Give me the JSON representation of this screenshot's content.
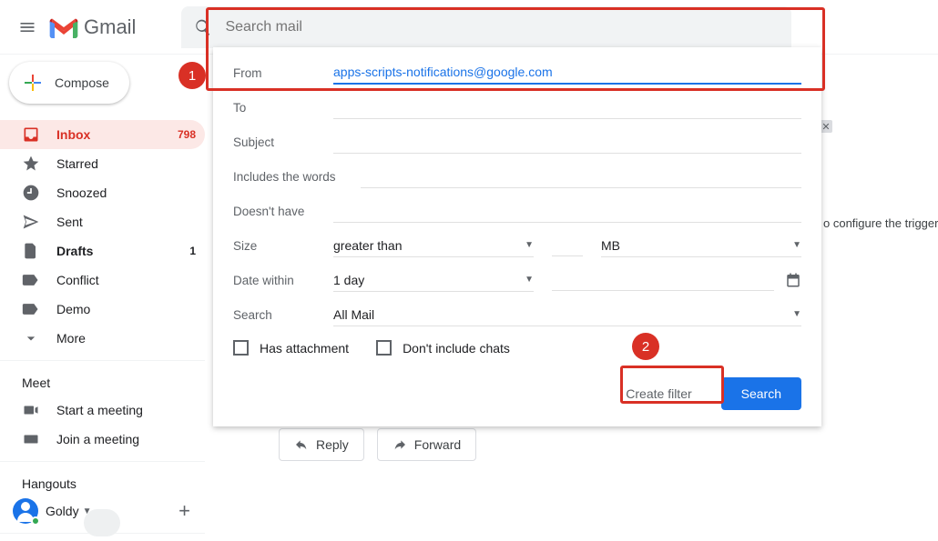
{
  "header": {
    "brand": "Gmail",
    "search_placeholder": "Search mail"
  },
  "compose_label": "Compose",
  "nav": [
    {
      "label": "Inbox",
      "count": "798"
    },
    {
      "label": "Starred"
    },
    {
      "label": "Snoozed"
    },
    {
      "label": "Sent"
    },
    {
      "label": "Drafts",
      "count": "1"
    },
    {
      "label": "Conflict"
    },
    {
      "label": "Demo"
    },
    {
      "label": "More"
    }
  ],
  "meet": {
    "title": "Meet",
    "start": "Start a meeting",
    "join": "Join a meeting"
  },
  "hangouts": {
    "title": "Hangouts",
    "user": "Goldy"
  },
  "filter": {
    "from_label": "From",
    "from_value": "apps-scripts-notifications@google.com",
    "to_label": "To",
    "subject_label": "Subject",
    "includes_label": "Includes the words",
    "doesnt_label": "Doesn't have",
    "size_label": "Size",
    "size_op": "greater than",
    "size_unit": "MB",
    "date_label": "Date within",
    "date_val": "1 day",
    "search_label": "Search",
    "search_val": "All Mail",
    "attach_label": "Has attachment",
    "chats_label": "Don't include chats",
    "create_filter": "Create filter",
    "search_btn": "Search"
  },
  "back_text": "o configure the triggers fo",
  "callouts": {
    "one": "1",
    "two": "2"
  },
  "reply": "Reply",
  "forward": "Forward"
}
